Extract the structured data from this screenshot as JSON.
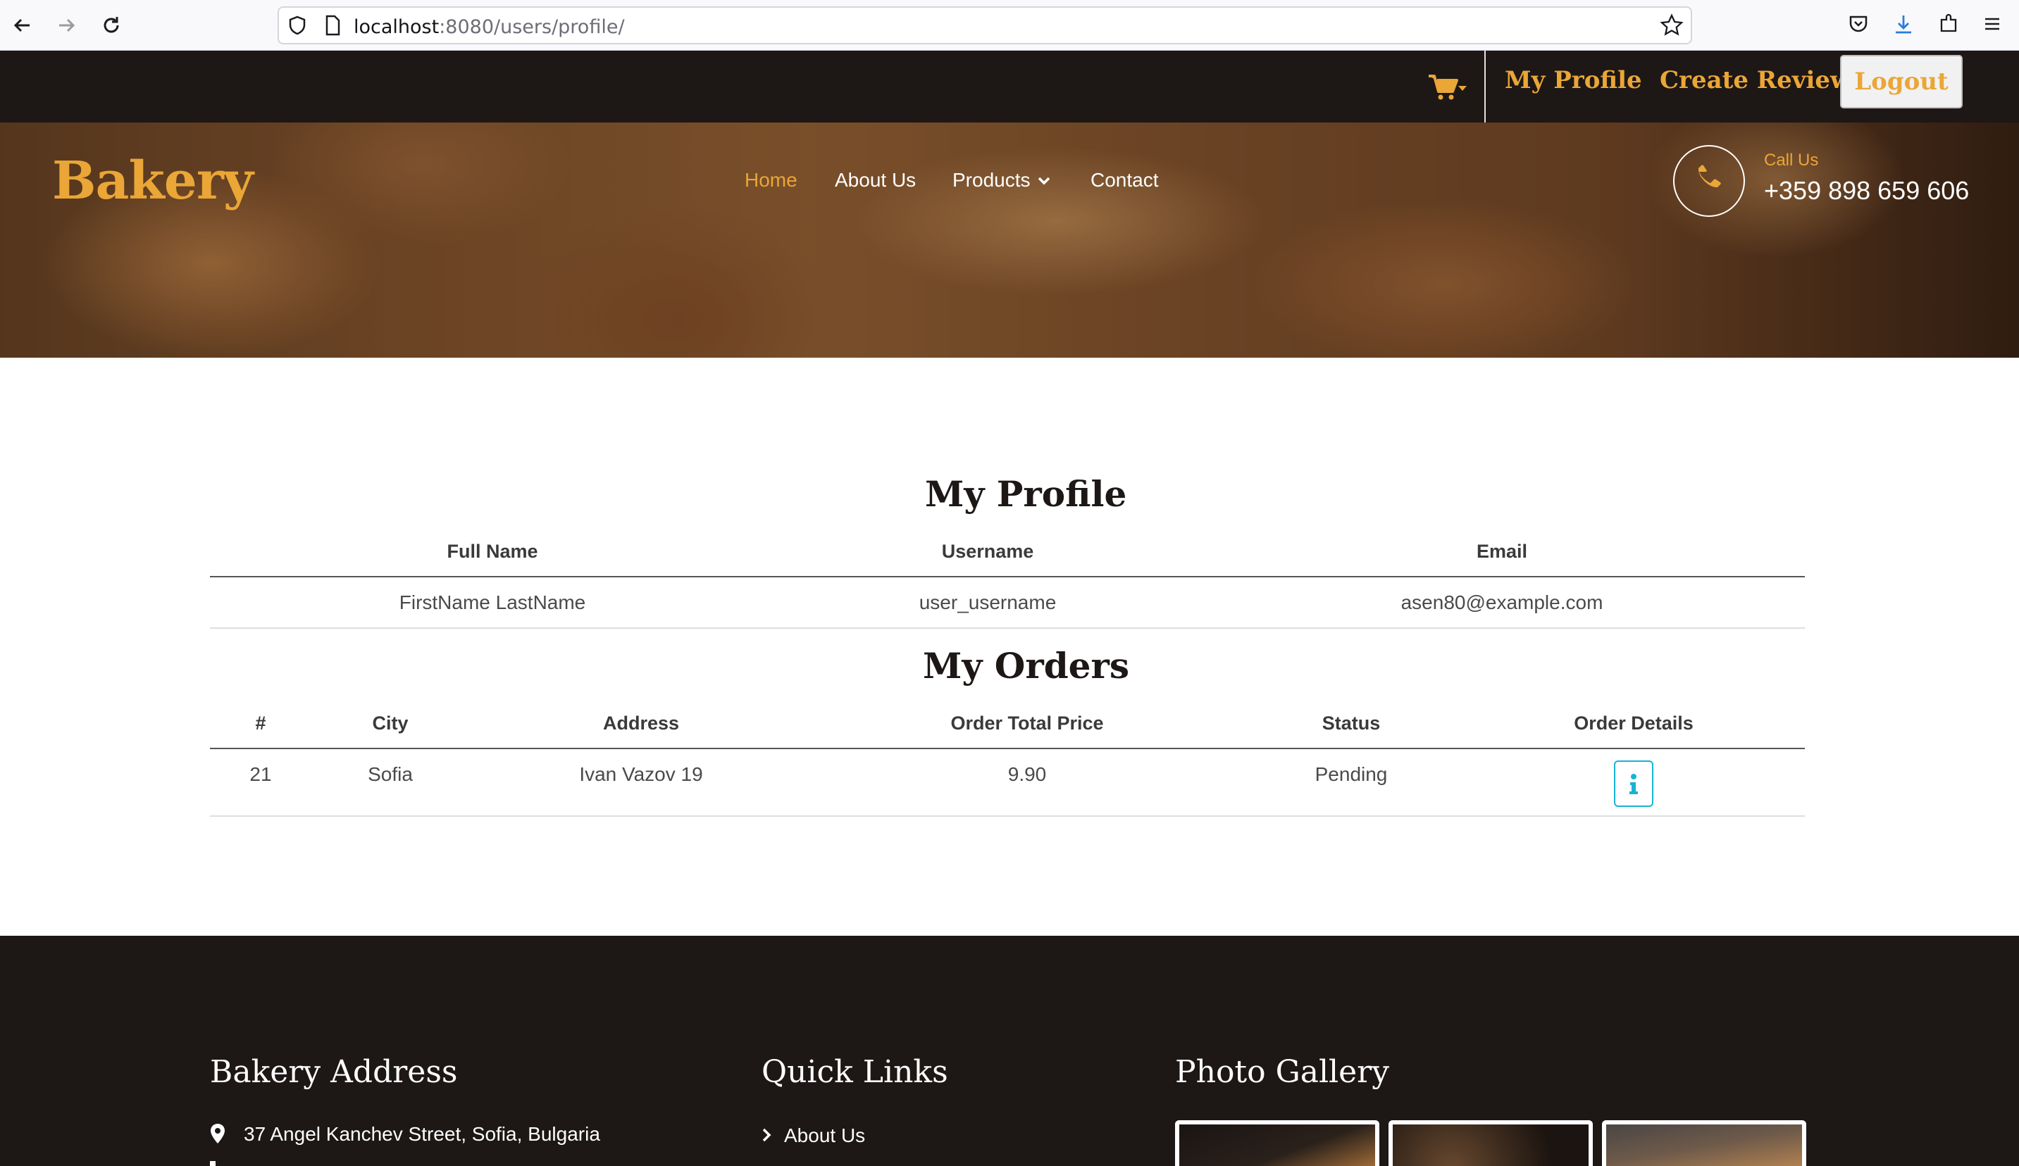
{
  "browser": {
    "url_host": "localhost",
    "url_path": ":8080/users/profile/"
  },
  "topbar": {
    "links": [
      "My Profile",
      "Create Review"
    ],
    "logout_label": "Logout"
  },
  "header": {
    "logo": "Bakery",
    "nav": [
      "Home",
      "About Us",
      "Products",
      "Contact"
    ],
    "call_label": "Call Us",
    "phone": "+359 898 659 606"
  },
  "profile": {
    "title": "My Profile",
    "columns": [
      "Full Name",
      "Username",
      "Email"
    ],
    "row": [
      "FirstName LastName",
      "user_username",
      "asen80@example.com"
    ]
  },
  "orders": {
    "title": "My Orders",
    "columns": [
      "#",
      "City",
      "Address",
      "Order Total Price",
      "Status",
      "Order Details"
    ],
    "rows": [
      {
        "id": "21",
        "city": "Sofia",
        "address": "Ivan Vazov 19",
        "total": "9.90",
        "status": "Pending"
      }
    ]
  },
  "footer": {
    "address_title": "Bakery Address",
    "address": "37 Angel Kanchev Street, Sofia, Bulgaria",
    "links_title": "Quick Links",
    "links": [
      "About Us"
    ],
    "gallery_title": "Photo Gallery"
  },
  "colors": {
    "accent": "#eaa636",
    "dark": "#1d1716",
    "info": "#17b3d3"
  },
  "icons": [
    "back-icon",
    "forward-icon",
    "reload-icon",
    "shield-icon",
    "page-icon",
    "star-icon",
    "pocket-icon",
    "download-icon",
    "extensions-icon",
    "menu-icon",
    "cart-icon",
    "phone-icon",
    "info-icon",
    "map-pin-icon",
    "chevron-right-icon"
  ]
}
